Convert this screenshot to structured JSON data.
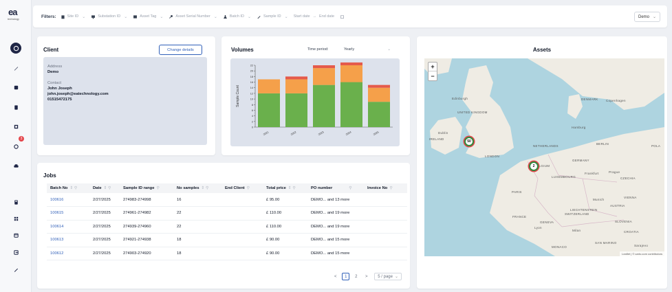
{
  "logo": {
    "text": "ea",
    "sub": "technology"
  },
  "sidebar": {
    "notification_count": "3"
  },
  "filters": {
    "label": "Filters:",
    "items": [
      {
        "placeholder": "Site ID",
        "icon": "building-icon"
      },
      {
        "placeholder": "Substation ID",
        "icon": "monitor-icon"
      },
      {
        "placeholder": "Asset Tag",
        "icon": "grid-icon"
      },
      {
        "placeholder": "Asset Serial Number",
        "icon": "key-icon"
      },
      {
        "placeholder": "Batch ID",
        "icon": "flask-icon"
      },
      {
        "placeholder": "Sample ID",
        "icon": "pencil-icon"
      },
      {
        "placeholder": "Start date",
        "icon": ""
      },
      {
        "placeholder": "End date",
        "icon": ""
      }
    ],
    "date_separator": "→",
    "company": "Demo"
  },
  "client": {
    "title": "Client",
    "change_button": "Change details",
    "address_label": "Address",
    "address": "Demo",
    "contact_label": "Contact",
    "contact_name": "John Joseph",
    "contact_email": "john.joseph@eatechnology.com",
    "contact_phone": "01515472175"
  },
  "volumes": {
    "title": "Volumes",
    "period_label": "Time period:",
    "period_value": "Yearly"
  },
  "chart_data": {
    "type": "bar",
    "stacked": true,
    "categories": [
      "2021",
      "2022",
      "2023",
      "2024",
      "2025"
    ],
    "series": [
      {
        "values": [
          12,
          12,
          15,
          16,
          9
        ],
        "color": "#6ab04c"
      },
      {
        "values": [
          5,
          5,
          6,
          6,
          5
        ],
        "color": "#f5a04a"
      },
      {
        "values": [
          0,
          1,
          1,
          1,
          1
        ],
        "color": "#e55a4b"
      }
    ],
    "ylabel": "Sample Count",
    "ylim": [
      0,
      22
    ],
    "yticks": [
      0,
      2,
      4,
      6,
      8,
      10,
      12,
      14,
      16,
      18,
      20,
      22
    ]
  },
  "assets": {
    "title": "Assets"
  },
  "map": {
    "zoom_in": "+",
    "zoom_out": "−",
    "attribution": "Leaflet | © carto.com contributors",
    "labels": [
      {
        "text": "UNITED KINGDOM"
      },
      {
        "text": "IRELAND"
      },
      {
        "text": "Dublin"
      },
      {
        "text": "LONDON"
      },
      {
        "text": "DENMARK"
      },
      {
        "text": "Copenhagen"
      },
      {
        "text": "Hamburg"
      },
      {
        "text": "NETHERLANDS"
      },
      {
        "text": "BERLIN"
      },
      {
        "text": "POLA"
      },
      {
        "text": "GERMANY"
      },
      {
        "text": "BELGIUM"
      },
      {
        "text": "LUXEMBOURG"
      },
      {
        "text": "Frankfurt"
      },
      {
        "text": "Prague"
      },
      {
        "text": "CZECHIA"
      },
      {
        "text": "PARIS"
      },
      {
        "text": "Munich"
      },
      {
        "text": "VIENNA"
      },
      {
        "text": "AUSTRIA"
      },
      {
        "text": "FRANCE"
      },
      {
        "text": "LIECHTENSTEIN"
      },
      {
        "text": "SWITZERLAND"
      },
      {
        "text": "GENEVA"
      },
      {
        "text": "Lyon"
      },
      {
        "text": "Milan"
      },
      {
        "text": "SLOVENIA"
      },
      {
        "text": "CROATIA"
      },
      {
        "text": "MONACO"
      },
      {
        "text": "SAN MARINO"
      },
      {
        "text": "Sarajevo"
      },
      {
        "text": "Edinburgh"
      }
    ],
    "clusters": [
      {
        "count": "50",
        "color": "#2e8b3d"
      },
      {
        "count": "2",
        "color": "#2e8b3d"
      }
    ]
  },
  "jobs": {
    "title": "Jobs",
    "columns": [
      "Batch No",
      "Date",
      "Sample ID range",
      "No samples",
      "End Client",
      "Total price",
      "PO number",
      "Invoice No"
    ],
    "rows": [
      [
        "100616",
        "2/27/2025",
        "274983-274998",
        "16",
        "",
        "£ 95.00",
        "DEMO... and 13 more",
        ""
      ],
      [
        "100615",
        "2/27/2025",
        "274961-274982",
        "22",
        "",
        "£ 110.00",
        "DEMO... and 19 more",
        ""
      ],
      [
        "100614",
        "2/27/2025",
        "274939-274960",
        "22",
        "",
        "£ 110.00",
        "DEMO... and 19 more",
        ""
      ],
      [
        "100613",
        "2/27/2025",
        "274921-274938",
        "18",
        "",
        "£ 90.00",
        "DEMO... and 15 more",
        ""
      ],
      [
        "100612",
        "2/27/2025",
        "274903-274920",
        "18",
        "",
        "£ 90.00",
        "DEMO... and 15 more",
        ""
      ]
    ],
    "pager": {
      "prev": "<",
      "pages": [
        "1",
        "2"
      ],
      "next": ">",
      "page_size": "5 / page"
    }
  }
}
